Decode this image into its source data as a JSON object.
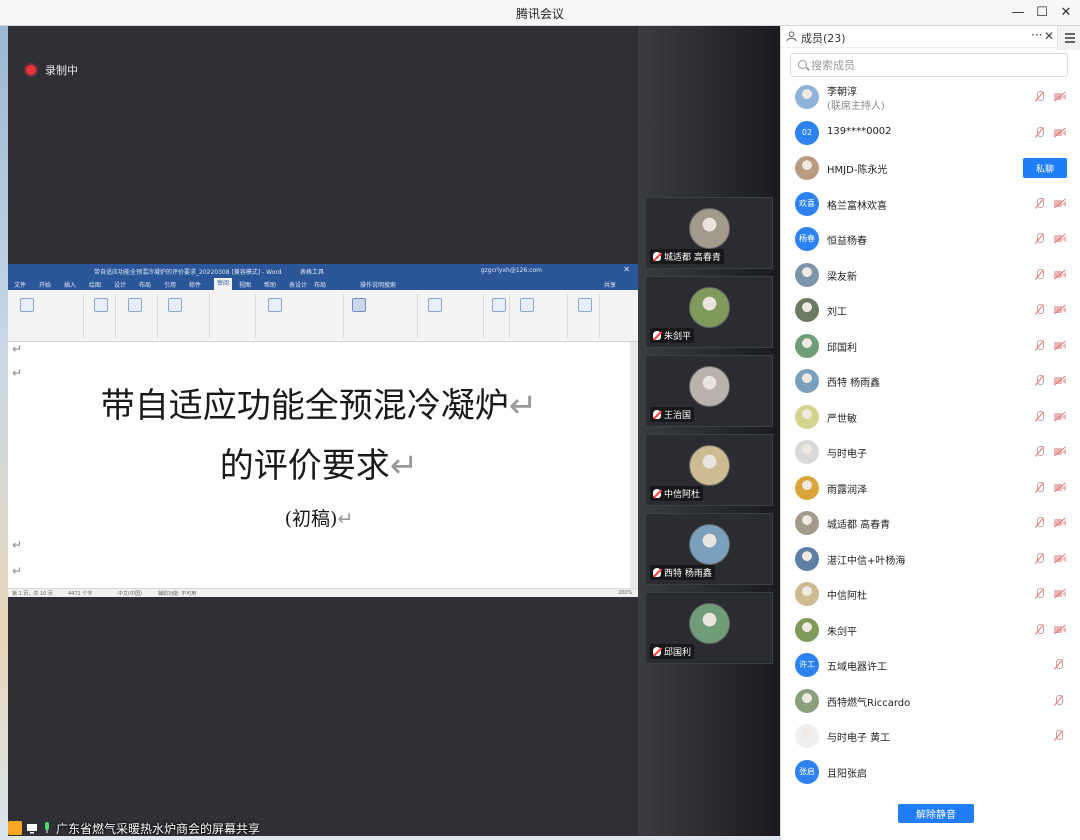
{
  "window": {
    "title": "腾讯会议",
    "minimize": "—",
    "maximize": "☐",
    "close": "✕"
  },
  "recording": {
    "label": "录制中"
  },
  "word": {
    "title": "带自适应功能全预混冷凝炉的评价要求_20220308 [兼容模式] - Word",
    "context_tab": "表格工具",
    "user": "gzgcrlyxh@126.com",
    "tabs": [
      "文件",
      "开始",
      "插入",
      "绘图",
      "设计",
      "布局",
      "引用",
      "邮件",
      "审阅",
      "视图",
      "帮助",
      "表设计",
      "布局"
    ],
    "active_tab": "审阅",
    "tell_me": "操作说明搜索",
    "share": "共享",
    "doc_title_line1": "带自适应功能全预混冷凝炉",
    "doc_title_line2": "的评价要求",
    "doc_subtitle": "(初稿)",
    "para_mark": "↵",
    "status_page": "第 1 页，共 10 页",
    "status_words": "4471 个字",
    "status_lang": "中文(中国)",
    "status_access": "辅助功能: 不可用",
    "status_zoom": "200%"
  },
  "videos": [
    {
      "name": "城适都 高春青",
      "face": "#a49a8c"
    },
    {
      "name": "朱剑平",
      "face": "#7f9a5a"
    },
    {
      "name": "王治国",
      "face": "#b9b2ad"
    },
    {
      "name": "中信阿杜",
      "face": "#cdbb92"
    },
    {
      "name": "西特 杨雨鑫",
      "face": "#7aa0be"
    },
    {
      "name": "邱国利",
      "face": "#6f9d79"
    }
  ],
  "members": {
    "title": "成员(23)",
    "more": "···",
    "close": "✕",
    "search_placeholder": "搜索成员",
    "private_chat": "私聊",
    "unmute_all": "解除静音",
    "list": [
      {
        "name": "李朝淳",
        "sub": "(联席主持人)",
        "avatar": "img",
        "color": "#8fb3d6"
      },
      {
        "name": "139****0002",
        "avatar": "text",
        "text": "02"
      },
      {
        "name": "HMJD-陈永光",
        "avatar": "img",
        "color": "#b99b82",
        "chat": true
      },
      {
        "name": "格兰富林欢喜",
        "avatar": "text",
        "text": "欢喜"
      },
      {
        "name": "恒益杨春",
        "avatar": "text",
        "text": "杨春"
      },
      {
        "name": "梁友新",
        "avatar": "img",
        "color": "#7c95ad"
      },
      {
        "name": "刘工",
        "avatar": "img",
        "color": "#6b7a62"
      },
      {
        "name": "邱国利",
        "avatar": "img",
        "color": "#6f9d79"
      },
      {
        "name": "西特 杨雨鑫",
        "avatar": "img",
        "color": "#7aa0be"
      },
      {
        "name": "严世敏",
        "avatar": "img",
        "color": "#d7d48f"
      },
      {
        "name": "与时电子",
        "avatar": "img",
        "color": "#d9d9d9"
      },
      {
        "name": "雨露润泽",
        "avatar": "img",
        "color": "#d9a43a"
      },
      {
        "name": "城适都 高春青",
        "avatar": "img",
        "color": "#a49a8c"
      },
      {
        "name": "湛江中信+叶杨海",
        "avatar": "img",
        "color": "#5c7fa3"
      },
      {
        "name": "中信阿杜",
        "avatar": "img",
        "color": "#cdbb92"
      },
      {
        "name": "朱剑平",
        "avatar": "img",
        "color": "#7f9a5a"
      },
      {
        "name": "五域电器许工",
        "avatar": "text",
        "text": "许工",
        "nocam": true
      },
      {
        "name": "西特燃气Riccardo",
        "avatar": "img",
        "color": "#8aa07a",
        "nocam": true
      },
      {
        "name": "与时电子 黄工",
        "avatar": "img",
        "color": "#efefef",
        "nocam": true
      },
      {
        "name": "且阳张启",
        "avatar": "text",
        "text": "张启",
        "nocam": true,
        "nomic": true
      }
    ]
  },
  "share": {
    "text": "广东省燃气采暖热水炉商会的屏幕共享"
  }
}
